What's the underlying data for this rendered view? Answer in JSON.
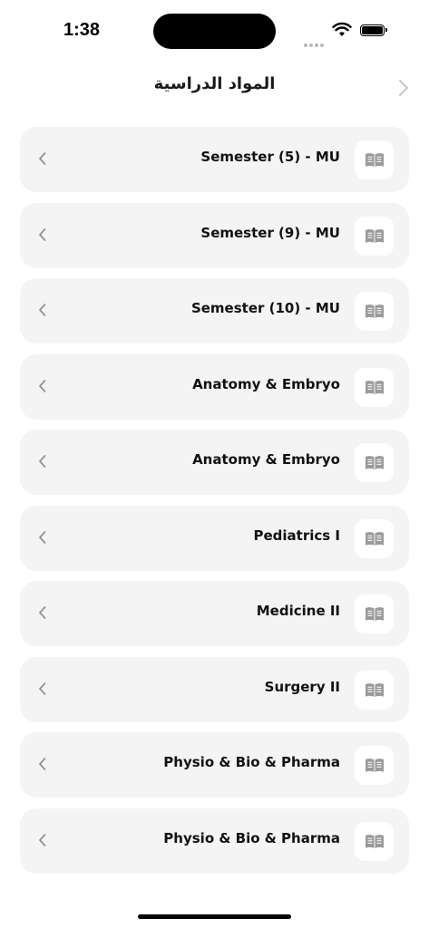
{
  "status_bar": {
    "time": "1:38",
    "icons": [
      "cellular-signal-icon",
      "wifi-icon",
      "battery-icon"
    ]
  },
  "header": {
    "title": "المواد الدراسية",
    "back_icon": "chevron-right-icon"
  },
  "courses": [
    {
      "label": "Semester (5) - MU",
      "icon": "book-icon",
      "chevron": "chevron-left-icon"
    },
    {
      "label": "Semester (9) - MU",
      "icon": "book-icon",
      "chevron": "chevron-left-icon"
    },
    {
      "label": "Semester (10) - MU",
      "icon": "book-icon",
      "chevron": "chevron-left-icon"
    },
    {
      "label": "Anatomy & Embryo",
      "icon": "book-icon",
      "chevron": "chevron-left-icon"
    },
    {
      "label": "Anatomy & Embryo",
      "icon": "book-icon",
      "chevron": "chevron-left-icon"
    },
    {
      "label": "Pediatrics I",
      "icon": "book-icon",
      "chevron": "chevron-left-icon"
    },
    {
      "label": "Medicine II",
      "icon": "book-icon",
      "chevron": "chevron-left-icon"
    },
    {
      "label": "Surgery II",
      "icon": "book-icon",
      "chevron": "chevron-left-icon"
    },
    {
      "label": "Physio & Bio & Pharma",
      "icon": "book-icon",
      "chevron": "chevron-left-icon"
    },
    {
      "label": "Physio & Bio & Pharma",
      "icon": "book-icon",
      "chevron": "chevron-left-icon"
    }
  ],
  "colors": {
    "card_background": "#f4f4f4",
    "icon_gray": "#9a9a9a",
    "chevron_gray": "#8e8e93"
  }
}
